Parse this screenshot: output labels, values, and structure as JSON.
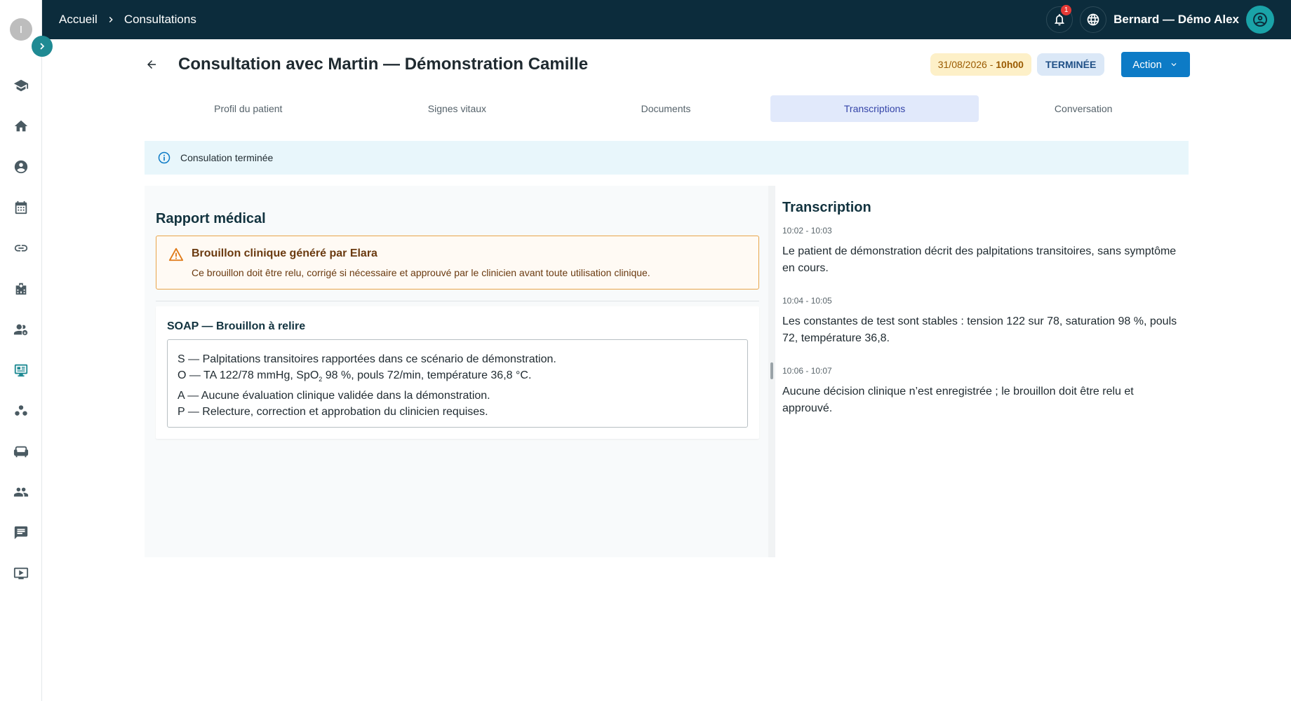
{
  "sidebar": {
    "logo_letter": "I",
    "icons": [
      "graduation-cap-icon",
      "home-icon",
      "patient-icon",
      "calendar-icon",
      "link-icon",
      "hospital-icon",
      "team-icon",
      "consultation-icon",
      "groups-icon",
      "sofa-icon",
      "people-icon",
      "chat-icon",
      "video-icon"
    ],
    "active": "consultation-icon"
  },
  "topbar": {
    "breadcrumb": [
      "Accueil",
      "Consultations"
    ],
    "notification_count": "1",
    "user_name": "Bernard — Démo Alex"
  },
  "header": {
    "title": "Consultation avec Martin — Démonstration Camille",
    "date": "31/08/2026 - ",
    "time": "10h00",
    "status": "TERMINÉE",
    "action_label": "Action"
  },
  "tabs": [
    {
      "label": "Profil du patient",
      "active": false
    },
    {
      "label": "Signes vitaux",
      "active": false
    },
    {
      "label": "Documents",
      "active": false
    },
    {
      "label": "Transcriptions",
      "active": true
    },
    {
      "label": "Conversation",
      "active": false
    }
  ],
  "info_banner": "Consulation terminée",
  "report": {
    "title": "Rapport médical",
    "warning_title": "Brouillon clinique généré par Elara",
    "warning_text": "Ce brouillon doit être relu, corrigé si nécessaire et approuvé par le clinicien avant toute utilisation clinique.",
    "soap_title": "SOAP — Brouillon à relire",
    "soap": {
      "s": "S — Palpitations transitoires rapportées dans ce scénario de démonstration.",
      "o_before": "O — TA 122/78 mmHg, SpO",
      "o_sub": "2",
      "o_after": " 98 %, pouls 72/min, température 36,8 °C.",
      "a": "A — Aucune évaluation clinique validée dans la démonstration.",
      "p": "P — Relecture, correction et approbation du clinicien requises."
    }
  },
  "transcription": {
    "title": "Transcription",
    "entries": [
      {
        "time": "10:02 - 10:03",
        "text": "Le patient de démonstration décrit des palpitations transitoires, sans symptôme en cours."
      },
      {
        "time": "10:04 - 10:05",
        "text": "Les constantes de test sont stables : tension 122 sur 78, saturation 98 %, pouls 72, température 36,8."
      },
      {
        "time": "10:06 - 10:07",
        "text": "Aucune décision clinique n’est enregistrée ; le brouillon doit être relu et approuvé."
      }
    ]
  },
  "colors": {
    "topbar": "#0c2c3c",
    "accent": "#1f8a93",
    "action": "#0d7bc6",
    "warning_border": "#e8a44a"
  }
}
